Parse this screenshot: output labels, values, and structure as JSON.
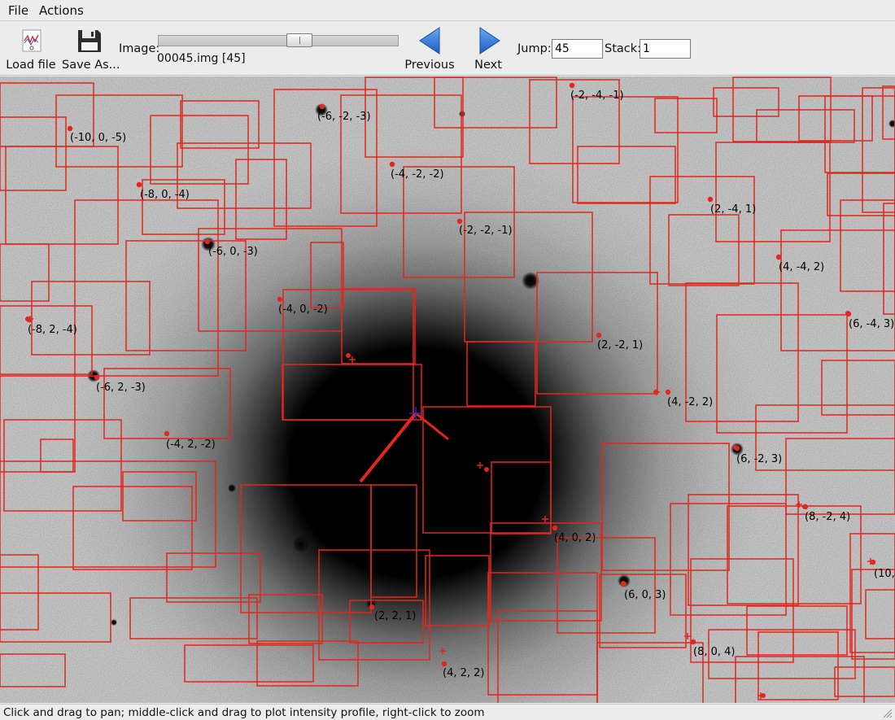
{
  "menubar": {
    "items": [
      "File",
      "Actions"
    ]
  },
  "toolbar": {
    "load_label": "Load file",
    "save_label": "Save As...",
    "image_label": "Image:",
    "image_name": "00045.img [45]",
    "slider_fraction": 0.6,
    "previous_label": "Previous",
    "next_label": "Next",
    "jump_label": "Jump:",
    "jump_value": "45",
    "stack_label": "Stack:",
    "stack_value": "1"
  },
  "colors": {
    "overlay": "#e0281e",
    "center_marker": "#2a2acc",
    "nav_arrow": "#2a6fd6"
  },
  "icons": {
    "load": "chart-file-icon",
    "save": "floppy-disk-icon",
    "previous": "left-arrow-icon",
    "next": "right-arrow-icon"
  },
  "reflections": [
    "(-2, -4, -1)",
    "(-6, -2, -3)",
    "(-10, 0, -5)",
    "(-4, -2, -2)",
    "(-8, 0, -4)",
    "(2, -4, 1)",
    "(-2, -2, -1)",
    "(-6, 0, -3)",
    "(4, -4, 2)",
    "(-4, 0, -2)",
    "(-8, 2, -4)",
    "(6, -4, 3)",
    "(2, -2, 1)",
    "(-6, 2, -3)",
    "(4, -2, 2)",
    "(-4, 2, -2)",
    "(6, -2, 3)",
    "(8, -2, 4)",
    "(4, 0, 2)",
    "(10,",
    "(6, 0, 3)",
    "(2, 2, 1)",
    "(8, 0, 4)",
    "(4, 2, 2)"
  ],
  "status": {
    "text": "Click and drag to pan; middle-click and drag to plot intensity profile, right-click to zoom"
  }
}
